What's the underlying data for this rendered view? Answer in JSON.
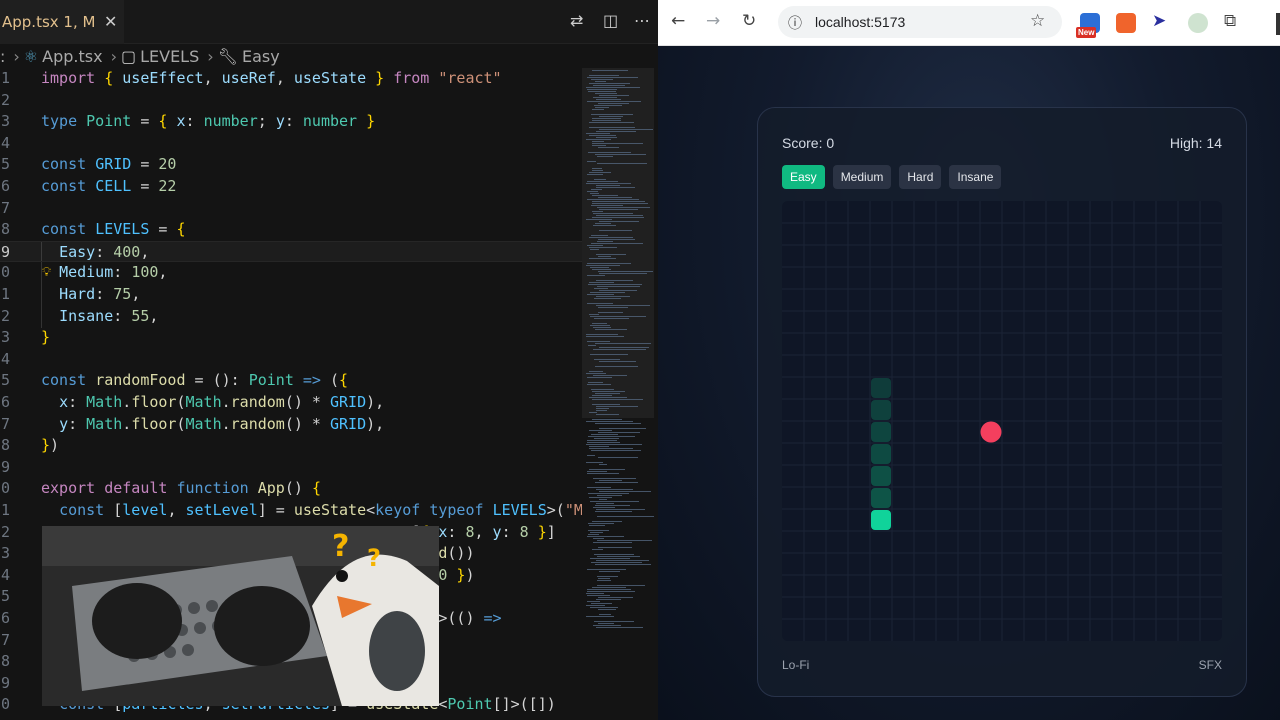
{
  "editor": {
    "tab": {
      "name": "App.tsx 1, M",
      "close_glyph": "✕"
    },
    "breadcrumb": {
      "lead_glyph": ":",
      "file": "App.tsx",
      "symbol": "LEVELS",
      "member": "Easy"
    },
    "minimap_color": "#5a6f8a",
    "current_line": 9
  },
  "browser": {
    "url": "localhost:5173",
    "extension_badge": "New"
  },
  "game": {
    "score_text": "Score: 0",
    "high_text": "High: 14",
    "levels": [
      {
        "label": "Easy",
        "active": true
      },
      {
        "label": "Medium",
        "active": false
      },
      {
        "label": "Hard",
        "active": false
      },
      {
        "label": "Insane",
        "active": false
      }
    ],
    "footer_left": "Lo-Fi",
    "footer_right": "SFX",
    "grid_cells": 20,
    "snake": [
      {
        "x": 4,
        "y": 8,
        "head": false
      },
      {
        "x": 4,
        "y": 9,
        "head": false
      },
      {
        "x": 4,
        "y": 10,
        "head": false
      },
      {
        "x": 4,
        "y": 11,
        "head": false
      },
      {
        "x": 4,
        "y": 12,
        "head": false
      },
      {
        "x": 4,
        "y": 13,
        "head": false
      },
      {
        "x": 4,
        "y": 14,
        "head": true
      }
    ],
    "food": {
      "x": 9,
      "y": 10
    },
    "colors": {
      "accent": "#10b981",
      "snake_body": "#0f6b54",
      "snake_head": "#10d39a",
      "food": "#f43f5e",
      "grid": "#1b2436"
    }
  }
}
